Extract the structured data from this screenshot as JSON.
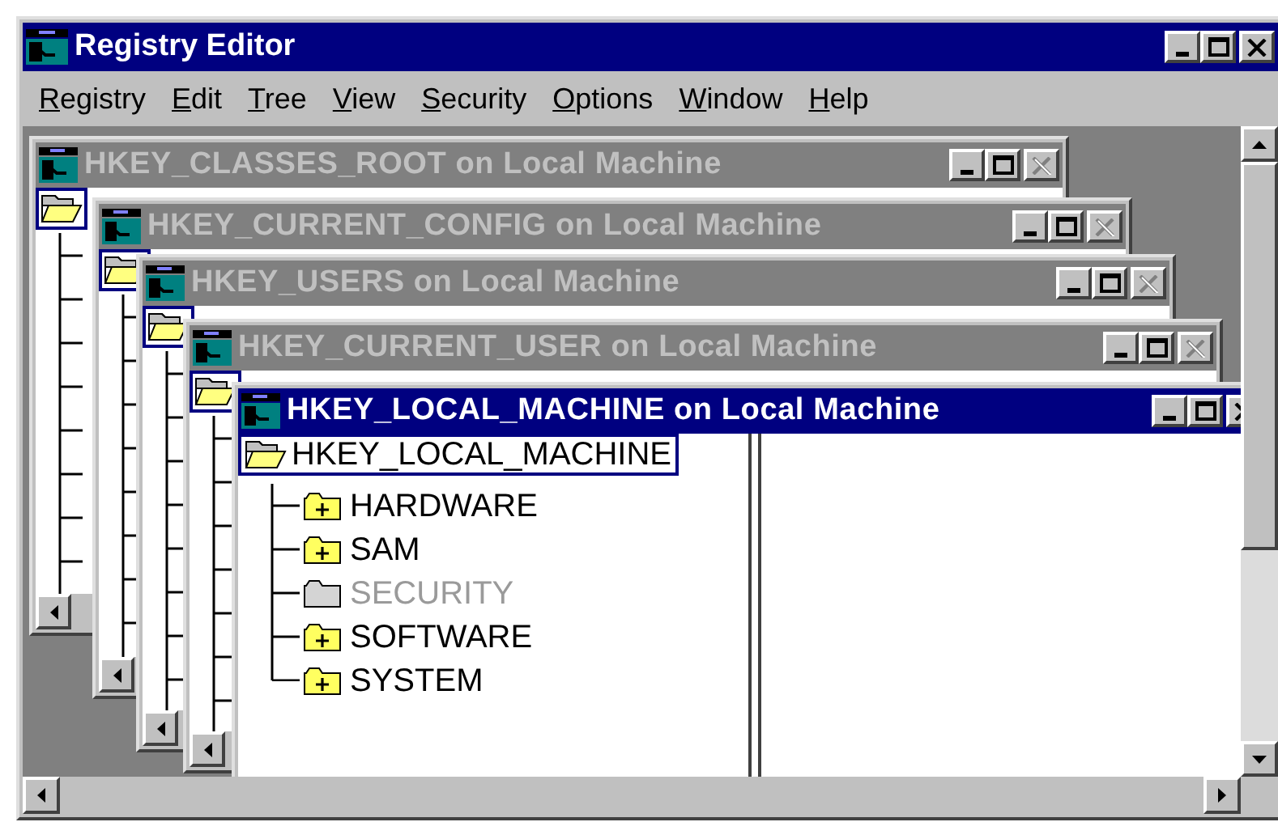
{
  "window": {
    "title": "Registry Editor"
  },
  "menu": [
    {
      "label": "Registry"
    },
    {
      "label": "Edit"
    },
    {
      "label": "Tree"
    },
    {
      "label": "View"
    },
    {
      "label": "Security"
    },
    {
      "label": "Options"
    },
    {
      "label": "Window"
    },
    {
      "label": "Help"
    }
  ],
  "documents": [
    {
      "title": "HKEY_CLASSES_ROOT on Local Machine",
      "active": false
    },
    {
      "title": "HKEY_CURRENT_CONFIG on Local Machine",
      "active": false
    },
    {
      "title": "HKEY_USERS on Local Machine",
      "active": false
    },
    {
      "title": "HKEY_CURRENT_USER on Local Machine",
      "active": false
    },
    {
      "title": "HKEY_LOCAL_MACHINE on Local Machine",
      "active": true,
      "tree": {
        "label": "HKEY_LOCAL_MACHINE",
        "selected": true,
        "expanded": true,
        "children": [
          {
            "label": "HARDWARE",
            "disabled": false
          },
          {
            "label": "SAM",
            "disabled": false
          },
          {
            "label": "SECURITY",
            "disabled": true
          },
          {
            "label": "SOFTWARE",
            "disabled": false
          },
          {
            "label": "SYSTEM",
            "disabled": false
          }
        ]
      }
    }
  ]
}
